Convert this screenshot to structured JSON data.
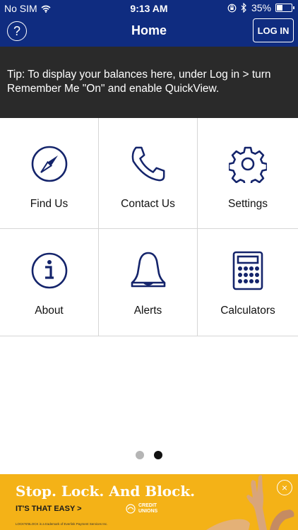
{
  "status_bar": {
    "carrier": "No SIM",
    "time": "9:13 AM",
    "battery": "35%",
    "battery_level": 0.35,
    "icons": [
      "wifi-icon",
      "rotation-lock-icon",
      "bluetooth-icon",
      "battery-icon"
    ]
  },
  "nav": {
    "help_label": "?",
    "title": "Home",
    "login_label": "LOG IN"
  },
  "tip": {
    "text": "Tip: To display your balances here, under Log in > turn Remember Me \"On\" and enable QuickView."
  },
  "tiles": [
    {
      "label": "Find Us",
      "icon": "compass-icon"
    },
    {
      "label": "Contact Us",
      "icon": "phone-icon"
    },
    {
      "label": "Settings",
      "icon": "gear-icon"
    },
    {
      "label": "About",
      "icon": "info-icon"
    },
    {
      "label": "Alerts",
      "icon": "bell-icon"
    },
    {
      "label": "Calculators",
      "icon": "calculator-icon"
    }
  ],
  "pager": {
    "count": 2,
    "active": 2
  },
  "ad": {
    "headline": "Stop. Lock. And Block.",
    "tagline": "IT'S THAT EASY >",
    "logo_text": "CREDIT UNIONS",
    "fine_print": "LOCK'N'BLOCK is a trademark of Everlink Payment Services Inc.",
    "close_label": "×"
  },
  "colors": {
    "brand_navy": "#0f2c80",
    "icon_navy": "#14246b",
    "tip_background": "#2a2a2a",
    "ad_background": "#f4b217"
  }
}
